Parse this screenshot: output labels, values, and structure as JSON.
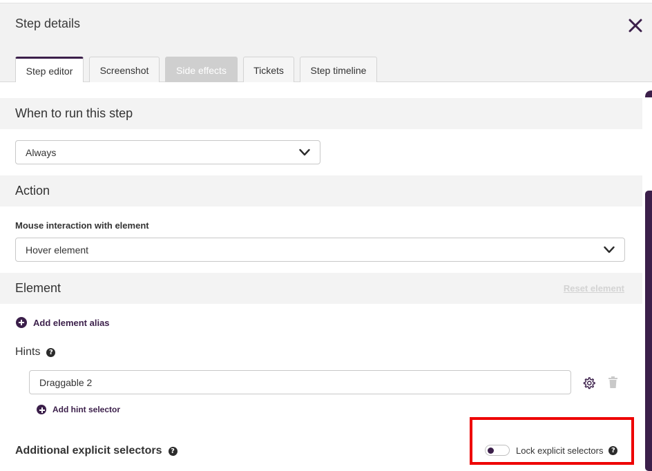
{
  "header": {
    "title": "Step details",
    "close_icon": "close-icon"
  },
  "tabs": [
    {
      "label": "Step editor",
      "state": "active"
    },
    {
      "label": "Screenshot",
      "state": "normal"
    },
    {
      "label": "Side effects",
      "state": "disabled"
    },
    {
      "label": "Tickets",
      "state": "normal"
    },
    {
      "label": "Step timeline",
      "state": "normal"
    }
  ],
  "when_section": {
    "title": "When to run this step",
    "select_value": "Always"
  },
  "action_section": {
    "title": "Action",
    "field_label": "Mouse interaction with element",
    "select_value": "Hover element"
  },
  "element_section": {
    "title": "Element",
    "reset_label": "Reset element",
    "add_alias_label": "Add element alias",
    "hints_label": "Hints",
    "hint_value": "Draggable 2",
    "add_hint_label": "Add hint selector",
    "explicit_label": "Additional explicit selectors",
    "lock_label": "Lock explicit selectors",
    "lock_enabled": false
  },
  "colors": {
    "accent": "#3b1f4a",
    "highlight": "#ee0000",
    "section_bg": "#f3f3f3"
  }
}
